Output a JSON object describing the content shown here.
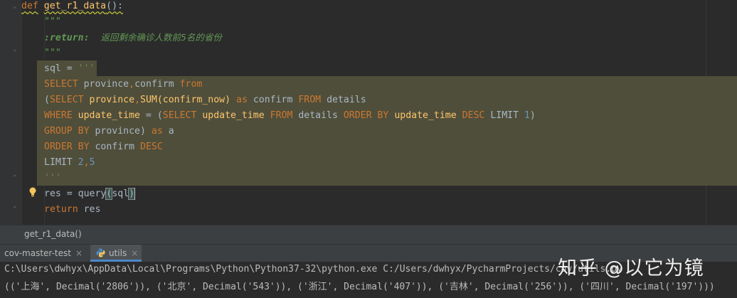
{
  "editor": {
    "lines": {
      "l1": {
        "def": "def",
        "name": "get_r1_data",
        "paren": "():"
      },
      "l2": {
        "text": "\"\"\""
      },
      "l3": {
        "tag": ":return:",
        "text": "返回剩余确诊人数前5名的省份"
      },
      "l4": {
        "text": "\"\"\""
      },
      "l5": {
        "var": "sql",
        "eq": " = ",
        "str": "'''"
      },
      "l6": {
        "a": "SELECT",
        "b": " province",
        "c": ",",
        "d": "confirm ",
        "e": "from"
      },
      "l7": {
        "a": "(",
        "b": "SELECT",
        "c": " province",
        "d": ",",
        "e": "SUM",
        "f": "(confirm_now) ",
        "g": "as",
        "h": " confirm ",
        "i": "FROM",
        "j": " details"
      },
      "l8": {
        "a": "WHERE",
        "b": " update_time",
        "c": " = (",
        "d": "SELECT",
        "e": " update_time",
        "f": " ",
        "g": "FROM",
        "h": " details ",
        "i": "ORDER BY",
        "j": " update_time ",
        "k": "DESC",
        "l": " LIMIT ",
        "m": "1",
        "n": ")"
      },
      "l9": {
        "a": "GROUP BY",
        "b": " province) ",
        "c": "as",
        "d": " a"
      },
      "l10": {
        "a": "ORDER BY",
        "b": " confirm ",
        "c": "DESC"
      },
      "l11": {
        "a": "LIMIT ",
        "b": "2",
        "c": ",",
        "d": "5"
      },
      "l12": {
        "text": "'''"
      },
      "l13": {
        "var": "res",
        "eq": " = ",
        "fn": "query",
        "open": "(",
        "arg": "sql",
        "close": ")"
      },
      "l14": {
        "kw": "return",
        "var": " res"
      }
    }
  },
  "breadcrumb": {
    "text": "get_r1_data()"
  },
  "run_tabs": {
    "tab1": {
      "label": "cov-master-test",
      "close": "×"
    },
    "tab2": {
      "label": "utils",
      "close": "×"
    }
  },
  "console": {
    "line1": "C:\\Users\\dwhyx\\AppData\\Local\\Programs\\Python\\Python37-32\\python.exe C:/Users/dwhyx/PycharmProjects/cov/utils.py",
    "line2": "(('上海', Decimal('2806')), ('北京', Decimal('543')), ('浙江', Decimal('407')), ('吉林', Decimal('256')), ('四川', Decimal('197')))"
  },
  "watermark": {
    "text": "知乎 @以它为镜"
  },
  "colors": {
    "editor_bg": "#2b2b2b",
    "keyword": "#cc7832",
    "function": "#ffc66d",
    "docstring": "#629755",
    "number": "#6897bb",
    "highlight": "#4f4e3a"
  },
  "icons": {
    "intention": "lightbulb-icon",
    "python_file": "python-icon"
  }
}
